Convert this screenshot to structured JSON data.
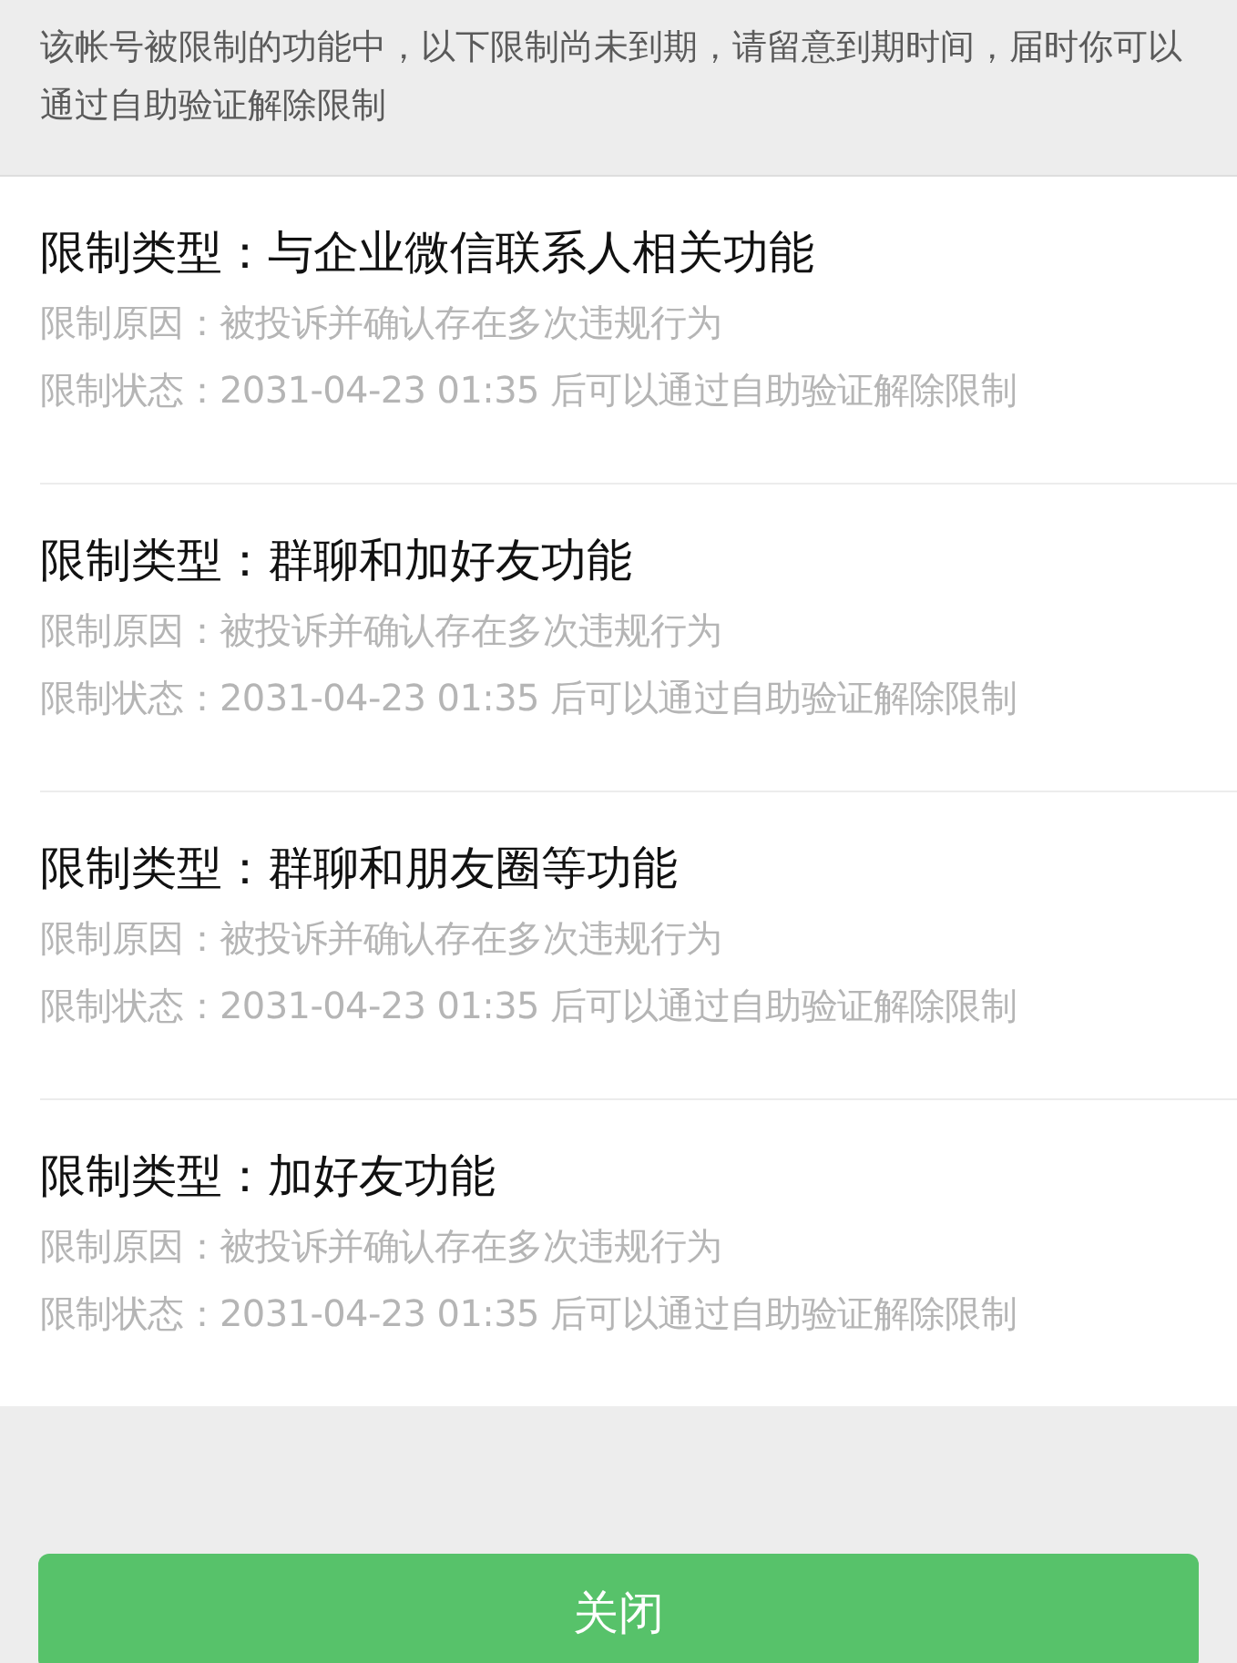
{
  "notice": "该帐号被限制的功能中，以下限制尚未到期，请留意到期时间，届时你可以通过自助验证解除限制",
  "restrictions": [
    {
      "type": "限制类型：与企业微信联系人相关功能",
      "reason": "限制原因：被投诉并确认存在多次违规行为",
      "status": "限制状态：2031-04-23 01:35 后可以通过自助验证解除限制"
    },
    {
      "type": "限制类型：群聊和加好友功能",
      "reason": "限制原因：被投诉并确认存在多次违规行为",
      "status": "限制状态：2031-04-23 01:35 后可以通过自助验证解除限制"
    },
    {
      "type": "限制类型：群聊和朋友圈等功能",
      "reason": "限制原因：被投诉并确认存在多次违规行为",
      "status": "限制状态：2031-04-23 01:35 后可以通过自助验证解除限制"
    },
    {
      "type": "限制类型：加好友功能",
      "reason": "限制原因：被投诉并确认存在多次违规行为",
      "status": "限制状态：2031-04-23 01:35 后可以通过自助验证解除限制"
    }
  ],
  "button": "关闭"
}
